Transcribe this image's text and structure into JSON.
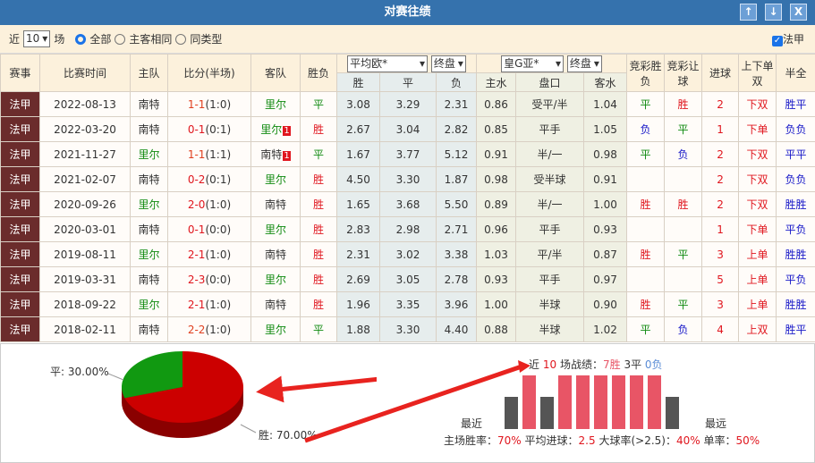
{
  "title": "对赛往绩",
  "buttons": {
    "up": "↑",
    "down": "↓",
    "close": "X"
  },
  "filter": {
    "prefix": "近",
    "count": "10",
    "suffix": "场",
    "options": [
      "全部",
      "主客相同",
      "同类型"
    ],
    "league_check": "法甲"
  },
  "headers": {
    "league": "赛事",
    "date": "比赛时间",
    "home": "主队",
    "score": "比分(半场)",
    "away": "客队",
    "result": "胜负",
    "eu_company": "平均欧*",
    "eu_stage": "终盘",
    "ah_company": "皇G亚*",
    "ah_stage": "终盘",
    "win": "胜",
    "draw": "平",
    "lose": "负",
    "home_w": "主水",
    "line": "盘口",
    "away_w": "客水",
    "jc_result": "竞彩胜负",
    "jc_hc": "竞彩让球",
    "goals": "进球",
    "ou": "上下单双",
    "htft": "半全"
  },
  "rows": [
    {
      "league": "法甲",
      "date": "2022-08-13",
      "home": "南特",
      "home_c": "",
      "score": "1-1",
      "ht": "(1:0)",
      "away": "里尔",
      "away_c": "g",
      "rc_home": "",
      "rc_away": "",
      "res": "平",
      "w": "3.08",
      "d": "3.29",
      "l": "2.31",
      "hw": "0.86",
      "line": "受平/半",
      "aw": "1.04",
      "jc1": "平",
      "jc2": "胜",
      "goals": "2",
      "ou": "下双",
      "htft": "胜平"
    },
    {
      "league": "法甲",
      "date": "2022-03-20",
      "home": "南特",
      "home_c": "",
      "score": "0-1",
      "ht": "(0:1)",
      "away": "里尔",
      "away_c": "g",
      "rc_home": "",
      "rc_away": "1",
      "res": "胜",
      "w": "2.67",
      "d": "3.04",
      "l": "2.82",
      "hw": "0.85",
      "line": "平手",
      "aw": "1.05",
      "jc1": "负",
      "jc2": "平",
      "goals": "1",
      "ou": "下单",
      "htft": "负负"
    },
    {
      "league": "法甲",
      "date": "2021-11-27",
      "home": "里尔",
      "home_c": "g",
      "score": "1-1",
      "ht": "(1:1)",
      "away": "南特",
      "away_c": "",
      "rc_home": "",
      "rc_away": "1",
      "res": "平",
      "w": "1.67",
      "d": "3.77",
      "l": "5.12",
      "hw": "0.91",
      "line": "半/一",
      "aw": "0.98",
      "jc1": "平",
      "jc2": "负",
      "goals": "2",
      "ou": "下双",
      "htft": "平平"
    },
    {
      "league": "法甲",
      "date": "2021-02-07",
      "home": "南特",
      "home_c": "",
      "score": "0-2",
      "ht": "(0:1)",
      "away": "里尔",
      "away_c": "g",
      "rc_home": "",
      "rc_away": "",
      "res": "胜",
      "w": "4.50",
      "d": "3.30",
      "l": "1.87",
      "hw": "0.98",
      "line": "受半球",
      "aw": "0.91",
      "jc1": "",
      "jc2": "",
      "goals": "2",
      "ou": "下双",
      "htft": "负负"
    },
    {
      "league": "法甲",
      "date": "2020-09-26",
      "home": "里尔",
      "home_c": "g",
      "score": "2-0",
      "ht": "(1:0)",
      "away": "南特",
      "away_c": "",
      "rc_home": "",
      "rc_away": "",
      "res": "胜",
      "w": "1.65",
      "d": "3.68",
      "l": "5.50",
      "hw": "0.89",
      "line": "半/一",
      "aw": "1.00",
      "jc1": "胜",
      "jc2": "胜",
      "goals": "2",
      "ou": "下双",
      "htft": "胜胜"
    },
    {
      "league": "法甲",
      "date": "2020-03-01",
      "home": "南特",
      "home_c": "",
      "score": "0-1",
      "ht": "(0:0)",
      "away": "里尔",
      "away_c": "g",
      "rc_home": "",
      "rc_away": "",
      "res": "胜",
      "w": "2.83",
      "d": "2.98",
      "l": "2.71",
      "hw": "0.96",
      "line": "平手",
      "aw": "0.93",
      "jc1": "",
      "jc2": "",
      "goals": "1",
      "ou": "下单",
      "htft": "平负"
    },
    {
      "league": "法甲",
      "date": "2019-08-11",
      "home": "里尔",
      "home_c": "g",
      "score": "2-1",
      "ht": "(1:0)",
      "away": "南特",
      "away_c": "",
      "rc_home": "",
      "rc_away": "",
      "res": "胜",
      "w": "2.31",
      "d": "3.02",
      "l": "3.38",
      "hw": "1.03",
      "line": "平/半",
      "aw": "0.87",
      "jc1": "胜",
      "jc2": "平",
      "goals": "3",
      "ou": "上单",
      "htft": "胜胜"
    },
    {
      "league": "法甲",
      "date": "2019-03-31",
      "home": "南特",
      "home_c": "",
      "score": "2-3",
      "ht": "(0:0)",
      "away": "里尔",
      "away_c": "g",
      "rc_home": "",
      "rc_away": "",
      "res": "胜",
      "w": "2.69",
      "d": "3.05",
      "l": "2.78",
      "hw": "0.93",
      "line": "平手",
      "aw": "0.97",
      "jc1": "",
      "jc2": "",
      "goals": "5",
      "ou": "上单",
      "htft": "平负"
    },
    {
      "league": "法甲",
      "date": "2018-09-22",
      "home": "里尔",
      "home_c": "g",
      "score": "2-1",
      "ht": "(1:0)",
      "away": "南特",
      "away_c": "",
      "rc_home": "",
      "rc_away": "",
      "res": "胜",
      "w": "1.96",
      "d": "3.35",
      "l": "3.96",
      "hw": "1.00",
      "line": "半球",
      "aw": "0.90",
      "jc1": "胜",
      "jc2": "平",
      "goals": "3",
      "ou": "上单",
      "htft": "胜胜"
    },
    {
      "league": "法甲",
      "date": "2018-02-11",
      "home": "南特",
      "home_c": "",
      "score": "2-2",
      "ht": "(1:0)",
      "away": "里尔",
      "away_c": "g",
      "rc_home": "",
      "rc_away": "",
      "res": "平",
      "w": "1.88",
      "d": "3.30",
      "l": "4.40",
      "hw": "0.88",
      "line": "半球",
      "aw": "1.02",
      "jc1": "平",
      "jc2": "负",
      "goals": "4",
      "ou": "上双",
      "htft": "胜平"
    }
  ],
  "pie": {
    "draw_label": "平: 30.00%",
    "win_label": "胜: 70.00%",
    "win_pct": 70,
    "draw_pct": 30
  },
  "summary": {
    "prefix": "近",
    "n": "10",
    "mid": "场战绩：",
    "wins": "7胜",
    "draws": "3平",
    "losses": "0负",
    "recent": "最近",
    "far": "最远",
    "stats": [
      {
        "label": "主场胜率：",
        "value": "70%"
      },
      {
        "label": "平均进球：",
        "value": "2.5"
      },
      {
        "label": "大球率(>2.5)：",
        "value": "40%"
      },
      {
        "label": "单率：",
        "value": "50%"
      }
    ],
    "bars": [
      "平",
      "胜",
      "平",
      "胜",
      "胜",
      "胜",
      "胜",
      "胜",
      "胜",
      "平"
    ]
  },
  "colors": {
    "win": "#e85566",
    "draw": "#555555",
    "header": "#3572ad"
  }
}
